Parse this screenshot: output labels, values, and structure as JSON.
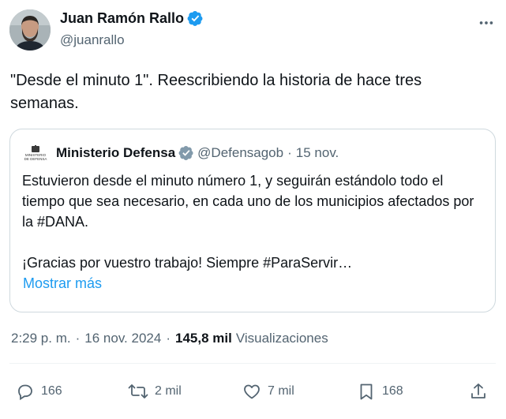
{
  "author": {
    "display_name": "Juan Ramón Rallo",
    "handle": "@juanrallo",
    "verified": true
  },
  "tweet": {
    "text": "\"Desde el minuto 1\". Reescribiendo la historia de hace tres semanas."
  },
  "quote": {
    "logo_text": [
      "MINISTERIO",
      "DE DEFENSA"
    ],
    "display_name": "Ministerio Defensa",
    "badge": "gray-verified",
    "handle": "@Defensagob",
    "separator": "·",
    "date": "15 nov.",
    "text_lines": [
      "Estuvieron desde el minuto número 1, y seguirán estándolo todo el tiempo que sea necesario, en cada uno de los municipios afectados por la #DANA.",
      "¡Gracias por vuestro trabajo! Siempre #ParaServir…"
    ],
    "show_more": "Mostrar más"
  },
  "meta": {
    "time": "2:29 p. m.",
    "separator": "·",
    "date": "16 nov. 2024",
    "views_count": "145,8 mil",
    "views_label": "Visualizaciones"
  },
  "actions": {
    "replies": "166",
    "reposts": "2 mil",
    "likes": "7 mil",
    "bookmarks": "168"
  },
  "colors": {
    "text": "#0f1419",
    "secondary": "#536471",
    "link": "#1d9bf0",
    "verified_blue": "#1d9bf0",
    "badge_gray": "#829aab",
    "border": "#cfd9de"
  },
  "icons": [
    "verified-badge-icon",
    "more-icon",
    "gray-badge-icon",
    "reply-icon",
    "repost-icon",
    "like-icon",
    "bookmark-icon",
    "share-icon"
  ]
}
